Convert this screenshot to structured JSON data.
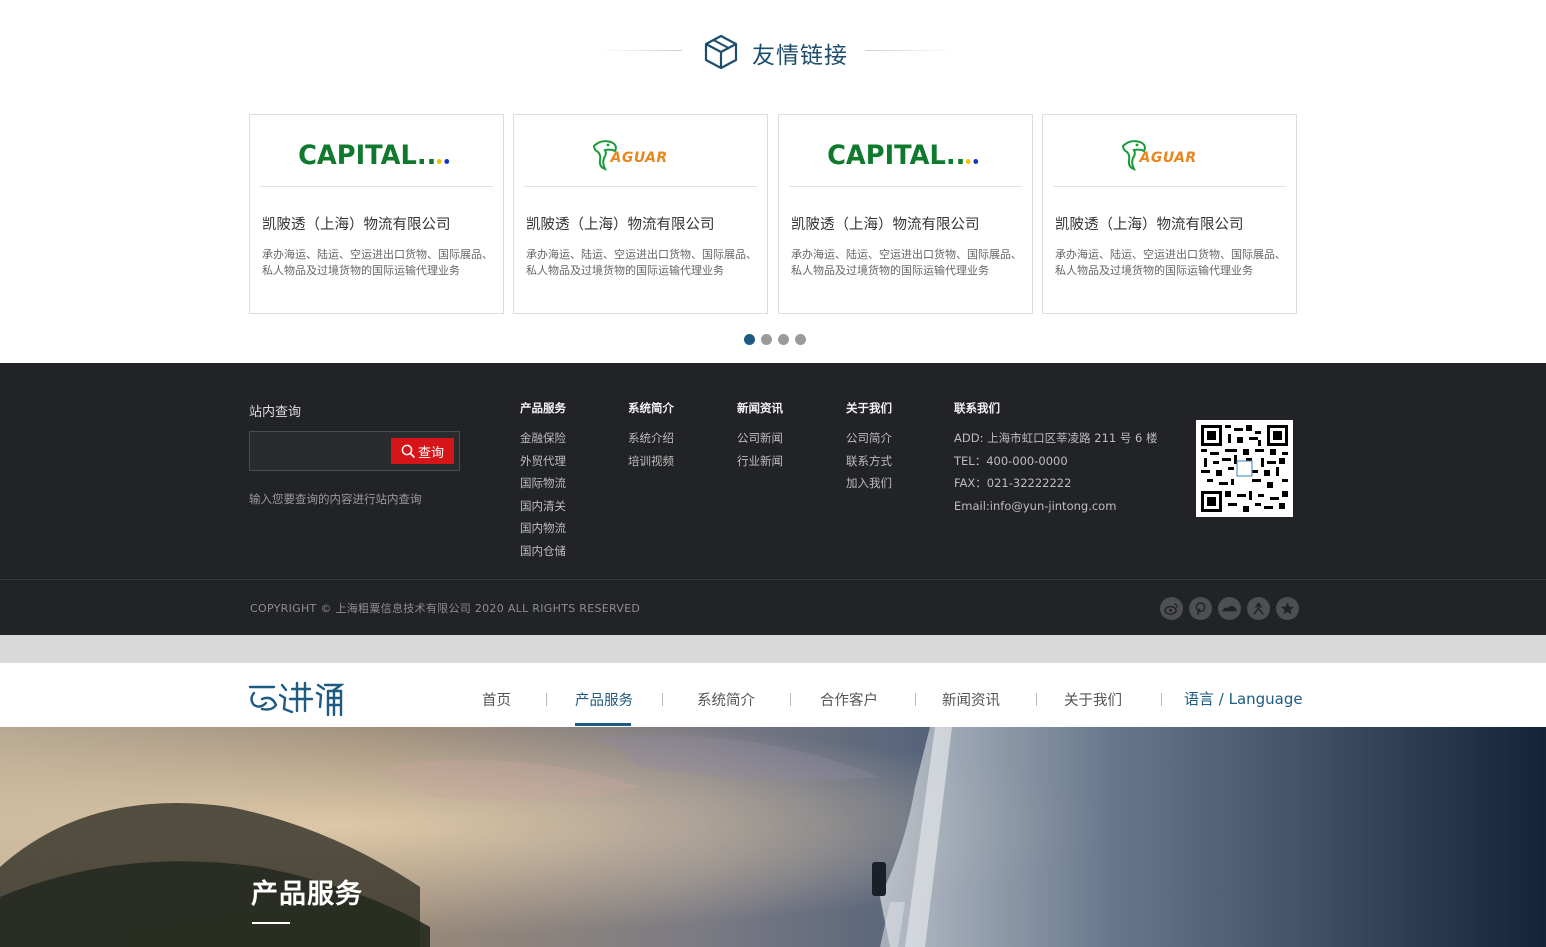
{
  "links": {
    "heading": "友情链接",
    "cards": [
      {
        "logo_type": "capital",
        "logo_text": "CAPITAL..",
        "title": "凯陂透（上海）物流有限公司",
        "desc": "承办海运、陆运、空运进出口货物、国际展品、私人物品及过境货物的国际运输代理业务"
      },
      {
        "logo_type": "jaguar",
        "logo_text": "AGUAR",
        "title": "凯陂透（上海）物流有限公司",
        "desc": "承办海运、陆运、空运进出口货物、国际展品、私人物品及过境货物的国际运输代理业务"
      },
      {
        "logo_type": "capital",
        "logo_text": "CAPITAL..",
        "title": "凯陂透（上海）物流有限公司",
        "desc": "承办海运、陆运、空运进出口货物、国际展品、私人物品及过境货物的国际运输代理业务"
      },
      {
        "logo_type": "jaguar",
        "logo_text": "AGUAR",
        "title": "凯陂透（上海）物流有限公司",
        "desc": "承办海运、陆运、空运进出口货物、国际展品、私人物品及过境货物的国际运输代理业务"
      }
    ],
    "active_page": 1,
    "page_count": 4
  },
  "footer": {
    "search": {
      "label": "站内查询",
      "button": "查询",
      "placeholder": "",
      "hint": "输入您要查询的内容进行站内查询"
    },
    "columns": [
      {
        "title": "产品服务",
        "items": [
          "金融保险",
          "外贸代理",
          "国际物流",
          "国内清关",
          "国内物流",
          "国内仓储"
        ]
      },
      {
        "title": "系统简介",
        "items": [
          "系统介绍",
          "培训视频"
        ]
      },
      {
        "title": "新闻资讯",
        "items": [
          "公司新闻",
          "行业新闻"
        ]
      },
      {
        "title": "关于我们",
        "items": [
          "公司简介",
          "联系方式",
          "加入我们"
        ]
      }
    ],
    "contact": {
      "title": "联系我们",
      "lines": [
        "ADD: 上海市虹口区莘凌路 211 号 6 楼",
        "TEL：400-000-0000",
        "FAX：021-32222222",
        "Email:info@yun-jintong.com"
      ]
    },
    "copyright": "COPYRIGHT  ©  上海粗粟信息技术有限公司  2020    ALL RIGHTS RESERVED",
    "social_icons": [
      "weibo-icon",
      "pinterest-icon",
      "cloud-icon",
      "renren-icon",
      "star-icon"
    ]
  },
  "nav": {
    "items": [
      "首页",
      "产品服务",
      "系统简介",
      "合作客户",
      "新闻资讯",
      "关于我们"
    ],
    "active": "产品服务",
    "language": "语言 / Language"
  },
  "banner": {
    "title": "产品服务"
  },
  "colors": {
    "accent": "#1d5b84",
    "footer_bg": "#222326",
    "search_button": "#d61518",
    "capital_green": "#0f7a2d",
    "jaguar_orange": "#e8861e"
  }
}
